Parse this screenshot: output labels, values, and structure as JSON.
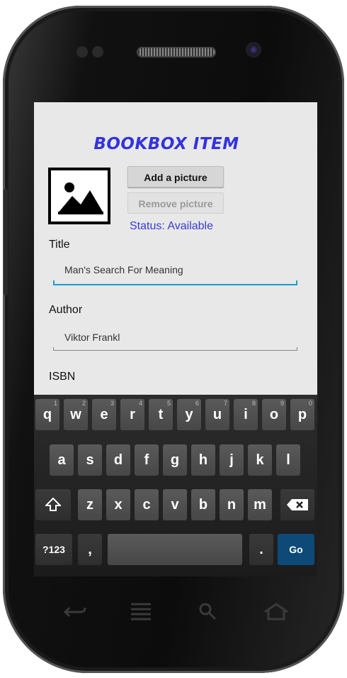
{
  "app": {
    "title": "BOOKBOX ITEM",
    "add_picture_label": "Add a picture",
    "remove_picture_label": "Remove picture",
    "status_text": "Status: Available"
  },
  "fields": {
    "title_label": "Title",
    "title_value": "Man's Search For Meaning",
    "author_label": "Author",
    "author_value": "Viktor Frankl",
    "isbn_label": "ISBN"
  },
  "keyboard": {
    "row1": [
      {
        "key": "q",
        "hint": "1"
      },
      {
        "key": "w",
        "hint": "2"
      },
      {
        "key": "e",
        "hint": "3"
      },
      {
        "key": "r",
        "hint": "4"
      },
      {
        "key": "t",
        "hint": "5"
      },
      {
        "key": "y",
        "hint": "6"
      },
      {
        "key": "u",
        "hint": "7"
      },
      {
        "key": "i",
        "hint": "8"
      },
      {
        "key": "o",
        "hint": "9"
      },
      {
        "key": "p",
        "hint": "0"
      }
    ],
    "row2": [
      "a",
      "s",
      "d",
      "f",
      "g",
      "h",
      "j",
      "k",
      "l"
    ],
    "row3": [
      "z",
      "x",
      "c",
      "v",
      "b",
      "n",
      "m"
    ],
    "symbols_label": "?123",
    "comma_label": ",",
    "period_label": ".",
    "go_label": "Go"
  },
  "colors": {
    "title": "#3333dd",
    "status": "#3a3ad4",
    "active_underline": "#1f9ccf",
    "go_key": "#0d4a78"
  }
}
